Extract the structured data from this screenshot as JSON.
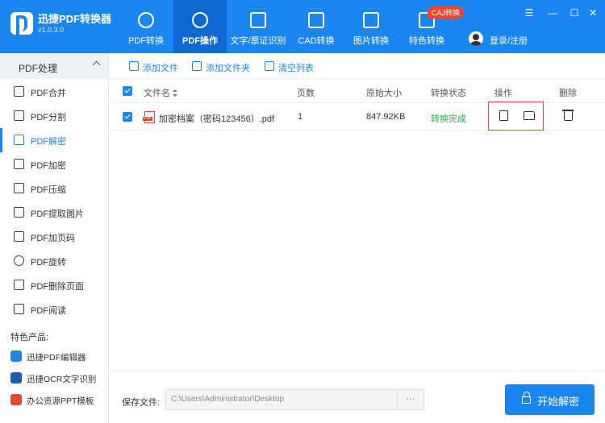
{
  "app": {
    "title": "迅捷PDF转换器",
    "version": "v1.0.3.0"
  },
  "nav": {
    "tabs": [
      {
        "label": "PDF转换",
        "icon": "convert-icon"
      },
      {
        "label": "PDF操作",
        "icon": "pdf-operate-icon"
      },
      {
        "label": "文字/票证识别",
        "icon": "ocr-icon"
      },
      {
        "label": "CAD转换",
        "icon": "cad-icon"
      },
      {
        "label": "图片转换",
        "icon": "image-icon"
      },
      {
        "label": "特色转换",
        "icon": "feature-icon"
      }
    ],
    "caj_badge": "CAJ转换",
    "login_label": "登录/注册"
  },
  "window_controls": {
    "menu": "☰",
    "minimize": "—",
    "maximize": "☐",
    "close": "✕"
  },
  "sidebar": {
    "group_label": "PDF处理",
    "items": [
      {
        "label": "PDF合并",
        "icon": "merge-icon"
      },
      {
        "label": "PDF分割",
        "icon": "split-icon"
      },
      {
        "label": "PDF解密",
        "icon": "unlock-icon"
      },
      {
        "label": "PDF加密",
        "icon": "shield-icon"
      },
      {
        "label": "PDF压缩",
        "icon": "compress-icon"
      },
      {
        "label": "PDF提取图片",
        "icon": "image-extract-icon"
      },
      {
        "label": "PDF加页码",
        "icon": "page-number-icon"
      },
      {
        "label": "PDF旋转",
        "icon": "rotate-icon"
      },
      {
        "label": "PDF删除页面",
        "icon": "delete-page-icon"
      },
      {
        "label": "PDF阅读",
        "icon": "book-icon"
      }
    ],
    "active_index": 2,
    "products_title": "特色产品:",
    "products": [
      {
        "label": "迅捷PDF编辑器",
        "icon": "pdf-editor-icon",
        "color": "#1b86f0"
      },
      {
        "label": "迅捷OCR文字识别",
        "icon": "ocr-product-icon",
        "color": "#1b5fb5"
      },
      {
        "label": "办公资源PPT模板",
        "icon": "ppt-template-icon",
        "color": "#e5483a"
      }
    ]
  },
  "toolbar": {
    "add_file": "添加文件",
    "add_folder": "添加文件夹",
    "clear_list": "清空列表"
  },
  "table": {
    "headers": {
      "file_name": "文件名",
      "pages": "页数",
      "original_size": "原始大小",
      "status": "转换状态",
      "actions": "操作",
      "delete": "删除"
    },
    "rows": [
      {
        "file_name": "加密档案（密码123456）.pdf",
        "pages": "1",
        "original_size": "847.92KB",
        "status": "转换完成",
        "checked": true
      }
    ]
  },
  "footer": {
    "save_label": "保存文件:",
    "save_path": "C:\\Users\\Administrator\\Desktop",
    "browse": "···",
    "start_button": "开始解密"
  },
  "colors": {
    "brand": "#1b86f0",
    "brand_dark": "#0f67d0",
    "status_ok": "#22b14c",
    "highlight": "#e5483a"
  }
}
